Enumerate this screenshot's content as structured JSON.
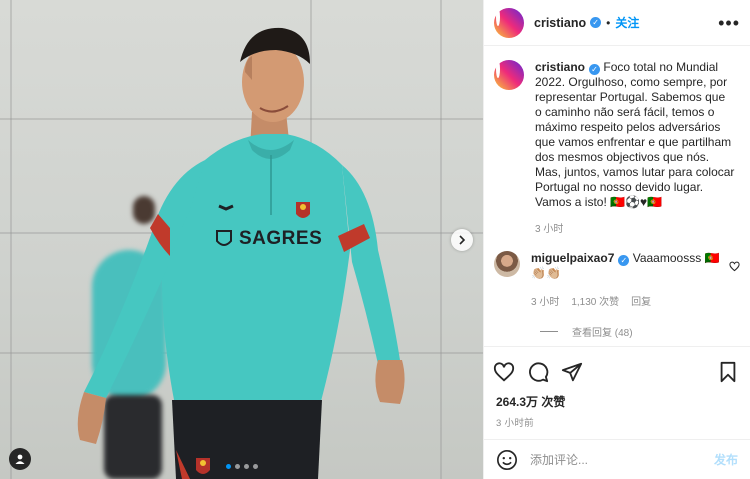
{
  "header": {
    "username": "cristiano",
    "separator": "•",
    "follow_label": "关注",
    "more_label": "•••"
  },
  "caption": {
    "username": "cristiano",
    "text": "Foco total no Mundial 2022. Orgulhoso, como sempre, por representar Portugal. Sabemos que o caminho não será fácil, temos o máximo respeito pelos adversários que vamos enfrentar e que partilham dos mesmos objectivos que nós. Mas, juntos, vamos lutar para colocar Portugal no nosso devido lugar. Vamos a isto! 🇵🇹⚽️♥🇵🇹",
    "time": "3 小时"
  },
  "comment": {
    "username": "miguelpaixao7",
    "text": "Vaaamoosss 🇵🇹👏🏼👏🏼",
    "time": "3 小时",
    "likes": "1,130 次赞",
    "reply_label": "回复",
    "view_replies": "查看回复 (48)"
  },
  "post": {
    "likes": "264.3万 次赞",
    "time": "3 小时前"
  },
  "add_comment": {
    "placeholder": "添加评论...",
    "post_label": "发布"
  },
  "media": {
    "slides_total": 4,
    "active_slide": 1,
    "shirt_sponsor": "SAGRES"
  },
  "colors": {
    "accent": "#0095f6",
    "verified": "#3897f0",
    "jersey": "#46c7c1",
    "post_disabled": "#b2dffc"
  }
}
